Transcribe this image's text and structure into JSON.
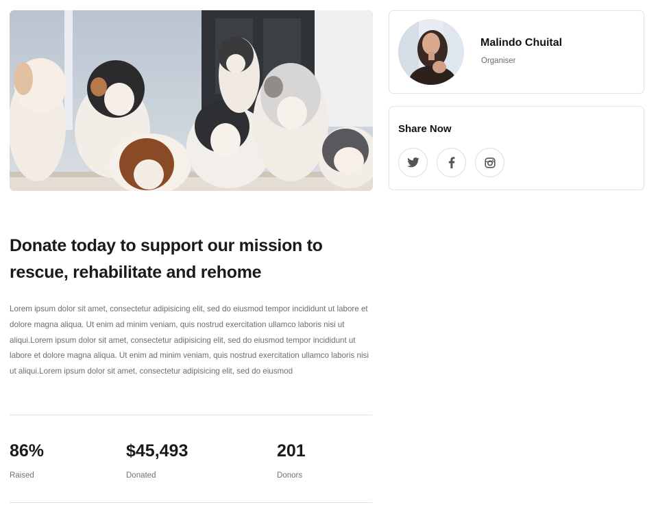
{
  "hero": {
    "image": "puppies-photo"
  },
  "campaign": {
    "title": "Donate today to support our mission to rescue, rehabilitate and rehome",
    "description": "Lorem ipsum dolor sit amet, consectetur adipisicing elit, sed do eiusmod tempor incididunt ut labore et dolore magna aliqua. Ut enim ad minim veniam, quis nostrud exercitation ullamco laboris nisi ut aliqui.Lorem ipsum dolor sit amet, consectetur adipisicing elit, sed do eiusmod tempor incididunt ut labore et dolore magna aliqua. Ut enim ad minim veniam, quis nostrud exercitation ullamco laboris nisi ut aliqui.Lorem ipsum dolor sit amet, consectetur adipisicing elit, sed do eiusmod"
  },
  "stats": [
    {
      "value": "86%",
      "label": "Raised"
    },
    {
      "value": "$45,493",
      "label": "Donated"
    },
    {
      "value": "201",
      "label": "Donors"
    }
  ],
  "organiser": {
    "name": "Malindo Chuital",
    "role": "Organiser"
  },
  "share": {
    "title": "Share Now",
    "icons": [
      "twitter-icon",
      "facebook-icon",
      "instagram-icon"
    ]
  },
  "colors": {
    "text": "#1a1a1a",
    "muted": "#6d6d6d",
    "border": "#e2e2e2",
    "icon": "#555555"
  }
}
